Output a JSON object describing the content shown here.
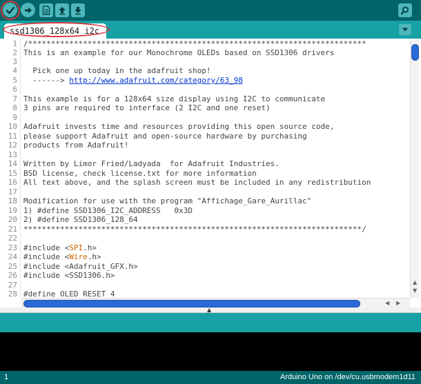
{
  "tab": {
    "name": "ssd1306_128x64_i2c"
  },
  "toolbar": {
    "buttons": [
      {
        "name": "verify",
        "icon": "checkmark-icon"
      },
      {
        "name": "upload",
        "icon": "arrow-right-icon"
      },
      {
        "name": "new",
        "icon": "new-file-icon"
      },
      {
        "name": "open",
        "icon": "arrow-up-icon"
      },
      {
        "name": "save",
        "icon": "arrow-down-icon"
      },
      {
        "name": "serial-monitor",
        "icon": "magnifier-icon"
      }
    ]
  },
  "editor": {
    "line_numbers": [
      "1",
      "2",
      "3",
      "4",
      "5",
      "6",
      "7",
      "8",
      "9",
      "10",
      "11",
      "12",
      "13",
      "14",
      "15",
      "16",
      "17",
      "18",
      "19",
      "20",
      "21",
      "22",
      "23",
      "24",
      "25",
      "26",
      "27",
      "28"
    ],
    "lines": {
      "l1": "/**************************************************************************",
      "l2": "This is an example for our Monochrome OLEDs based on SSD1306 drivers",
      "l3": "",
      "l4": "  Pick one up today in the adafruit shop!",
      "l5_prefix": "  ------> ",
      "l5_url": "http://www.adafruit.com/category/63_98",
      "l6": "",
      "l7": "This example is for a 128x64 size display using I2C to communicate",
      "l8": "3 pins are required to interface (2 I2C and one reset)",
      "l9": "",
      "l10": "Adafruit invests time and resources providing this open source code,",
      "l11": "please support Adafruit and open-source hardware by purchasing",
      "l12": "products from Adafruit!",
      "l13": "",
      "l14": "Written by Limor Fried/Ladyada  for Adafruit Industries.",
      "l15": "BSD license, check license.txt for more information",
      "l16": "All text above, and the splash screen must be included in any redistribution",
      "l17": "",
      "l18": "Modification for use with the program \"Affichage_Gare_Aurillac\"",
      "l19": "1) #define SSD1306_I2C_ADDRESS   0x3D",
      "l20": "2) #define SSD1306_128_64",
      "l21": "**************************************************************************/",
      "l22": "",
      "inc_kw": "#include",
      "l23_lt": " <",
      "l23_lib": "SPI",
      "l23_end": ".h>",
      "l24_lt": " <",
      "l24_lib": "Wire",
      "l24_end": ".h>",
      "l25_rest": " <Adafruit_GFX.h>",
      "l26_rest": " <SSD1306.h>",
      "l27": "",
      "l28": "#define OLED_RESET 4"
    }
  },
  "footer": {
    "line_number": "1",
    "board": "Arduino Uno on /dev/cu.usbmodem1d11"
  },
  "colors": {
    "toolbar": "#006468",
    "tabbar": "#17a1a5",
    "button": "#4db7bb",
    "highlight": "#d8363a",
    "keyword": "#cc6600",
    "link": "#0033cc",
    "scroll_thumb": "#2a6ad6"
  }
}
